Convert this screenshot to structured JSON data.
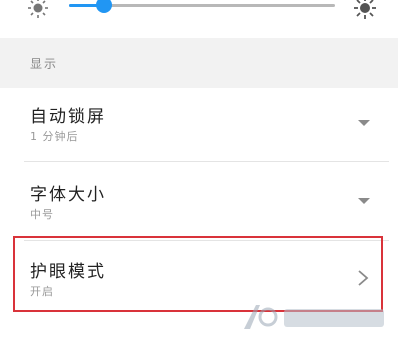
{
  "brightness": {
    "level": 0.13,
    "low_icon": "sun-dim-icon",
    "high_icon": "sun-bright-icon",
    "accent": "#2196f3"
  },
  "section": {
    "header": "显示"
  },
  "items": [
    {
      "title": "自动锁屏",
      "subtitle": "1 分钟后",
      "control": "dropdown-caret-icon"
    },
    {
      "title": "字体大小",
      "subtitle": "中号",
      "control": "dropdown-caret-icon"
    },
    {
      "title": "护眼模式",
      "subtitle": "开启",
      "control": "chevron-right-icon"
    }
  ],
  "highlight": {
    "color": "#d9333a"
  }
}
